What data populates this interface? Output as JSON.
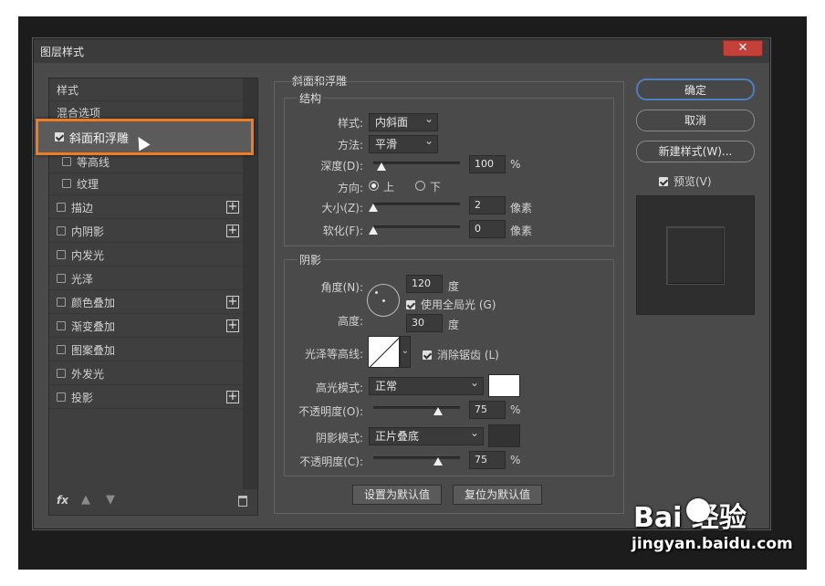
{
  "dialog": {
    "title": "图层样式",
    "close": "✕"
  },
  "left": {
    "items": [
      {
        "label": "样式",
        "checkbox": false,
        "plus": false
      },
      {
        "label": "混合选项",
        "checkbox": false,
        "plus": false
      },
      {
        "label": "斜面和浮雕",
        "checkbox": true,
        "checked": true,
        "plus": false
      },
      {
        "label": "等高线",
        "checkbox": true,
        "checked": false,
        "plus": false
      },
      {
        "label": "纹理",
        "checkbox": true,
        "checked": false,
        "plus": false
      },
      {
        "label": "描边",
        "checkbox": true,
        "checked": false,
        "plus": true
      },
      {
        "label": "内阴影",
        "checkbox": true,
        "checked": false,
        "plus": true
      },
      {
        "label": "内发光",
        "checkbox": true,
        "checked": false,
        "plus": false
      },
      {
        "label": "光泽",
        "checkbox": true,
        "checked": false,
        "plus": false
      },
      {
        "label": "颜色叠加",
        "checkbox": true,
        "checked": false,
        "plus": true
      },
      {
        "label": "渐变叠加",
        "checkbox": true,
        "checked": false,
        "plus": true
      },
      {
        "label": "图案叠加",
        "checkbox": true,
        "checked": false,
        "plus": false
      },
      {
        "label": "外发光",
        "checkbox": true,
        "checked": false,
        "plus": false
      },
      {
        "label": "投影",
        "checkbox": true,
        "checked": false,
        "plus": true
      }
    ],
    "fx": "fx",
    "icons": [
      "fx-icon",
      "arrow-up-icon",
      "arrow-down-icon",
      "trash-icon"
    ]
  },
  "bevel": {
    "section_title": "斜面和浮雕",
    "structure_title": "结构",
    "style_label": "样式:",
    "style_value": "内斜面",
    "technique_label": "方法:",
    "technique_value": "平滑",
    "depth_label": "深度(D):",
    "depth_value": "100",
    "depth_unit": "%",
    "direction_label": "方向:",
    "direction_up": "上",
    "direction_down": "下",
    "size_label": "大小(Z):",
    "size_value": "2",
    "size_unit": "像素",
    "soften_label": "软化(F):",
    "soften_value": "0",
    "soften_unit": "像素"
  },
  "shading": {
    "title": "阴影",
    "angle_label": "角度(N):",
    "angle_value": "120",
    "angle_unit": "度",
    "global_light": "使用全局光 (G)",
    "altitude_label": "高度:",
    "altitude_value": "30",
    "altitude_unit": "度",
    "gloss_label": "光泽等高线:",
    "antialias": "消除锯齿 (L)",
    "highlight_label": "高光模式:",
    "highlight_value": "正常",
    "hl_opacity_label": "不透明度(O):",
    "hl_opacity_value": "75",
    "hl_opacity_unit": "%",
    "shadow_label": "阴影模式:",
    "shadow_value": "正片叠底",
    "sh_opacity_label": "不透明度(C):",
    "sh_opacity_value": "75",
    "sh_opacity_unit": "%",
    "highlight_color": "#ffffff",
    "shadow_color": "#333333"
  },
  "footer": {
    "set_default": "设置为默认值",
    "reset_default": "复位为默认值"
  },
  "right": {
    "ok": "确定",
    "cancel": "取消",
    "new_style": "新建样式(W)...",
    "preview": "预览(V)"
  },
  "watermark": {
    "brand": "Bai  经验",
    "url": "jingyan.baidu.com"
  },
  "colors": {
    "accent": "#ef7b22",
    "close": "#c4413a"
  }
}
